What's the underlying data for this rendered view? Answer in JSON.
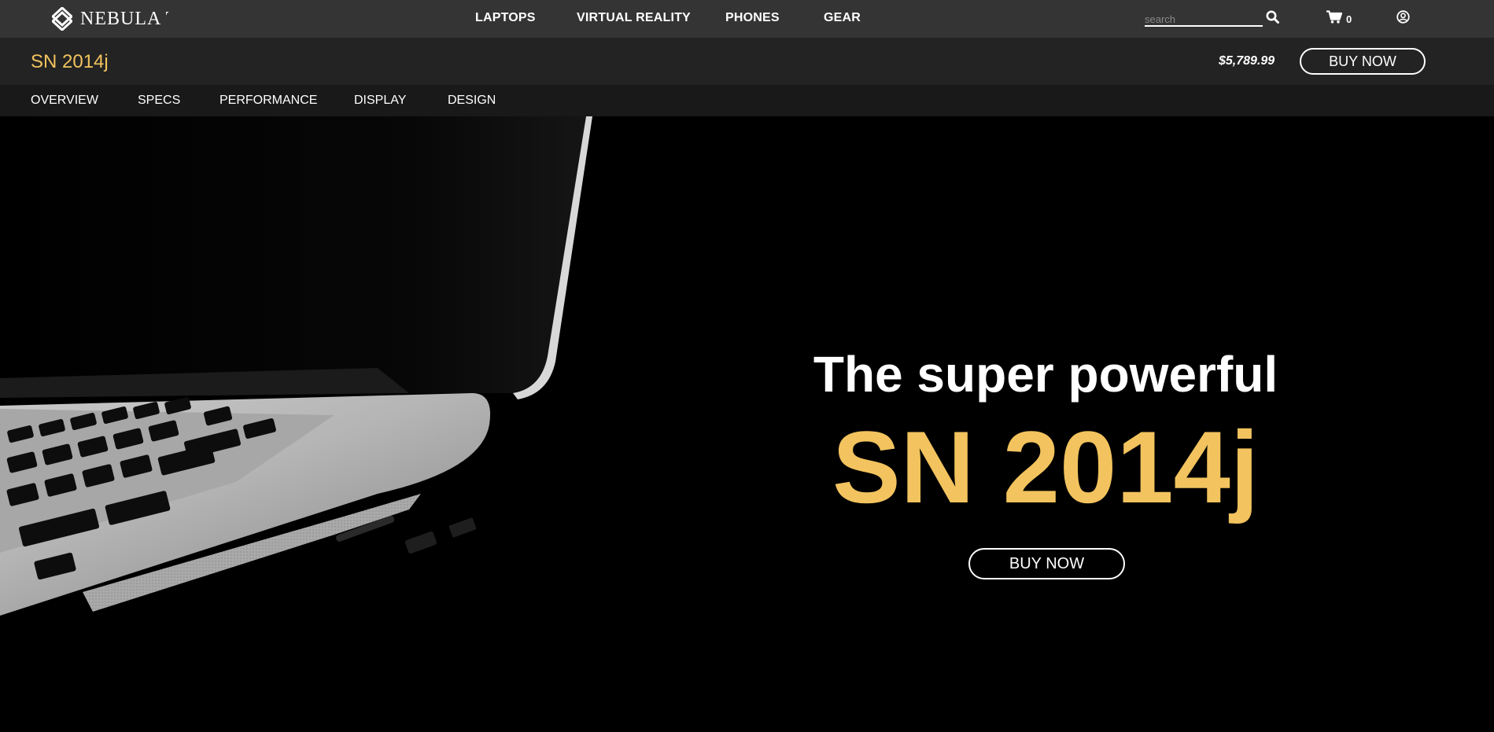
{
  "brand": {
    "name": "NEBULA T",
    "logo_icon": "diamond-logo-icon"
  },
  "nav": {
    "items": [
      {
        "label": "LAPTOPS"
      },
      {
        "label": "VIRTUAL REALITY"
      },
      {
        "label": "PHONES"
      },
      {
        "label": "GEAR"
      }
    ]
  },
  "search": {
    "placeholder": "search",
    "value": "",
    "icon": "search-icon"
  },
  "cart": {
    "count": "0",
    "icon": "cart-icon"
  },
  "account": {
    "icon": "user-circle-icon"
  },
  "product_bar": {
    "title": "SN 2014j",
    "price": "$5,789.99",
    "buy_label": "BUY NOW"
  },
  "sub_nav": {
    "items": [
      {
        "label": "OVERVIEW"
      },
      {
        "label": "SPECS"
      },
      {
        "label": "PERFORMANCE"
      },
      {
        "label": "DISPLAY"
      },
      {
        "label": "DESIGN"
      }
    ]
  },
  "hero": {
    "heading": "The super powerful",
    "model": "SN 2014j",
    "buy_label": "BUY NOW"
  },
  "colors": {
    "accent": "#f2c35e",
    "topnav_bg": "#343434",
    "productbar_bg": "#232323",
    "subnav_bg": "#191919",
    "hero_bg": "#000000"
  }
}
